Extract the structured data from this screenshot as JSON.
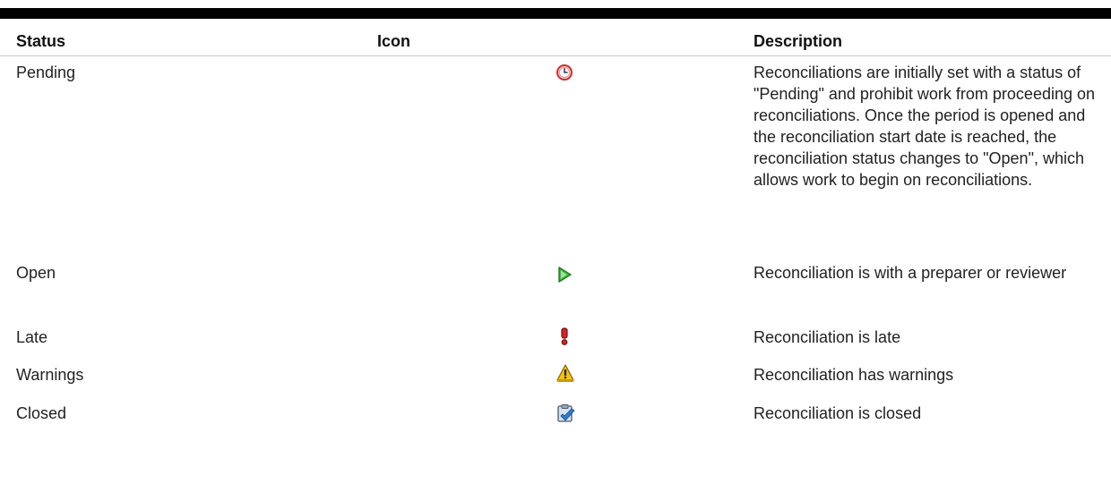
{
  "table": {
    "headers": {
      "status": "Status",
      "icon": "Icon",
      "description": "Description"
    },
    "rows": [
      {
        "status": "Pending",
        "icon": "clock-icon",
        "description": "Reconciliations are initially set with a status of \"Pending\" and prohibit work from proceeding on reconciliations. Once the period is opened and the reconciliation start date is reached, the reconciliation status changes to \"Open\", which allows work to begin on reconciliations."
      },
      {
        "status": "Open",
        "icon": "play-arrow-icon",
        "description": "Reconciliation is with a preparer or reviewer"
      },
      {
        "status": "Late",
        "icon": "exclamation-icon",
        "description": "Reconciliation is late"
      },
      {
        "status": "Warnings",
        "icon": "warning-triangle-icon",
        "description": "Reconciliation has warnings"
      },
      {
        "status": "Closed",
        "icon": "clipboard-check-icon",
        "description": "Reconciliation is closed"
      }
    ]
  },
  "colors": {
    "header_rule": "#000000",
    "clock": "#d23a3a",
    "play": "#3aa83a",
    "late": "#cc1f1f",
    "warning": "#e0b000",
    "closed": "#3a78c0"
  }
}
